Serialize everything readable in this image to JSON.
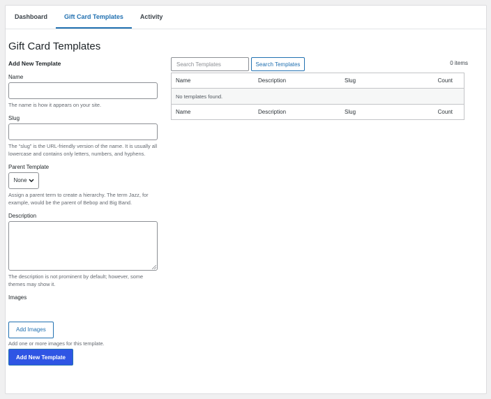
{
  "tabs": [
    {
      "label": "Dashboard",
      "active": false
    },
    {
      "label": "Gift Card Templates",
      "active": true
    },
    {
      "label": "Activity",
      "active": false
    }
  ],
  "page_title": "Gift Card Templates",
  "form": {
    "heading": "Add New Template",
    "name": {
      "label": "Name",
      "value": "",
      "help": "The name is how it appears on your site."
    },
    "slug": {
      "label": "Slug",
      "value": "",
      "help": "The “slug” is the URL-friendly version of the name. It is usually all lowercase and contains only letters, numbers, and hyphens."
    },
    "parent": {
      "label": "Parent Template",
      "selected": "None",
      "help": "Assign a parent term to create a hierarchy. The term Jazz, for example, would be the parent of Bebop and Big Band."
    },
    "description": {
      "label": "Description",
      "value": "",
      "help": "The description is not prominent by default; however, some themes may show it."
    },
    "images": {
      "label": "Images",
      "button": "Add Images",
      "help": "Add one or more images for this template."
    },
    "submit": "Add New Template"
  },
  "list": {
    "search_placeholder": "Search Templates",
    "search_button": "Search Templates",
    "count": "0 items",
    "columns": [
      "Name",
      "Description",
      "Slug",
      "Count"
    ],
    "empty_message": "No templates found."
  },
  "colors": {
    "accent": "#2271b1",
    "primary_button": "#2f55e4",
    "background": "#f0f0f1"
  }
}
